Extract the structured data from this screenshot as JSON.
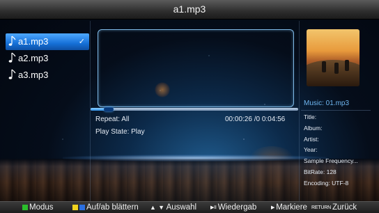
{
  "title_bar": {
    "title": "a1.mp3"
  },
  "playlist": {
    "items": [
      {
        "label": "a1.mp3",
        "selected": true,
        "checked": true
      },
      {
        "label": "a2.mp3",
        "selected": false,
        "checked": false
      },
      {
        "label": "a3.mp3",
        "selected": false,
        "checked": false
      }
    ],
    "check_glyph": "✓"
  },
  "player": {
    "repeat": "Repeat: All",
    "play_state": "Play State: Play",
    "time": "00:00:26 /0 0:04:56",
    "progress_fraction": 0.088
  },
  "track_info": {
    "music": "Music: 01.mp3",
    "fields": [
      "Title:",
      "Album:",
      "Artist:",
      "Year:",
      "Sample Frequency...",
      "BitRate: 128",
      "Encoding: UTF-8"
    ]
  },
  "bottom_bar": {
    "modus": {
      "label": "Modus",
      "color": "#2bbd2b"
    },
    "page": {
      "label": "Auf/ab blättern",
      "colors": [
        "#f0d21e",
        "#2b6fe0"
      ]
    },
    "select": {
      "label": "Auswahl",
      "up_glyph": "▲",
      "down_glyph": "▼"
    },
    "play": {
      "label": "Wiedergab",
      "key": "▶II"
    },
    "mark": {
      "label": "Markiere",
      "key": "▶"
    },
    "back": {
      "label": "Zurück",
      "key": "RETURN"
    }
  },
  "colors": {
    "accent": "#1670d8",
    "frame": "#7fb9e6",
    "music_title": "#6fb6f0"
  },
  "icons": [
    "music-note-icon",
    "check-icon",
    "up-arrow-icon",
    "down-arrow-icon",
    "play-pause-icon",
    "play-icon"
  ]
}
